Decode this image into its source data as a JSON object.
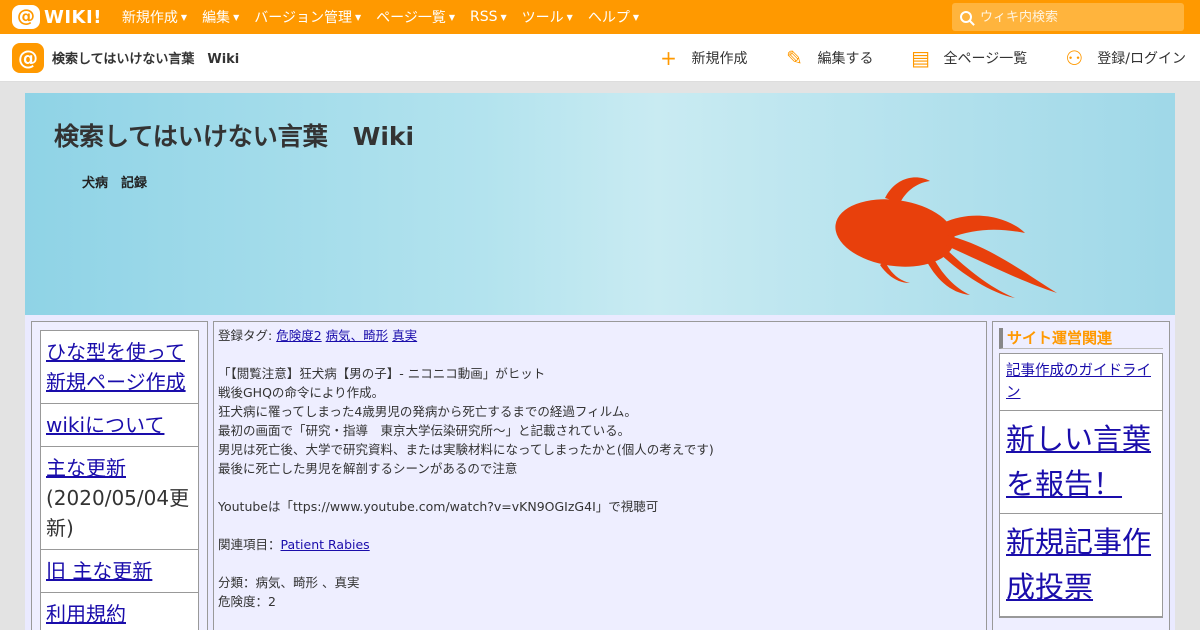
{
  "topbar": {
    "logo_at": "@",
    "logo_text": "WIKI!",
    "nav": [
      {
        "label": "新規作成"
      },
      {
        "label": "編集"
      },
      {
        "label": "バージョン管理"
      },
      {
        "label": "ページ一覧"
      },
      {
        "label": "RSS"
      },
      {
        "label": "ツール"
      },
      {
        "label": "ヘルプ"
      }
    ],
    "search_placeholder": "ウィキ内検索"
  },
  "subbar": {
    "logo_at": "@",
    "wiki_name": "検索してはいけない言葉　Wiki",
    "actions": [
      {
        "icon": "plus-icon",
        "glyph": "+",
        "label": "新規作成"
      },
      {
        "icon": "pencil-icon",
        "glyph": "✎",
        "label": "編集する"
      },
      {
        "icon": "document-icon",
        "glyph": "▤",
        "label": "全ページ一覧"
      },
      {
        "icon": "add-user-icon",
        "glyph": "⚇",
        "label": "登録/ログイン"
      }
    ]
  },
  "banner": {
    "title": "検索してはいけない言葉　Wiki",
    "subtitle": "犬病　記録"
  },
  "left_menu": {
    "items": [
      {
        "link": "ひな型を使って新規ページ作成",
        "note": ""
      },
      {
        "link": "wikiについて",
        "note": ""
      },
      {
        "link": "主な更新",
        "note": "(2020/05/04更新)"
      },
      {
        "link": "旧 主な更新",
        "note": ""
      },
      {
        "link": "利用規約",
        "note": ""
      }
    ]
  },
  "main": {
    "tags_label": "登録タグ: ",
    "tags": [
      "危険度2",
      "病気、畸形",
      "真実"
    ],
    "paragraph1": [
      "「【閲覧注意】狂犬病【男の子】- ニコニコ動画」がヒット",
      "戦後GHQの命令により作成。",
      "狂犬病に罹ってしまった4歳男児の発病から死亡するまでの経過フィルム。",
      "最初の画面で「研究・指導　東京大学伝染研究所～」と記載されている。",
      "男児は死亡後、大学で研究資料、または実験材料になってしまったかと(個人の考えです)",
      "最後に死亡した男児を解剖するシーンがあるので注意"
    ],
    "youtube_line": "Youtubeは「ttps://www.youtube.com/watch?v=vKN9OGIzG4I」で視聴可",
    "related_label": "関連項目：",
    "related_link": "Patient Rabies",
    "category_line": "分類：病気、畸形 、真実",
    "danger_line": "危険度：2"
  },
  "right_menu": {
    "heading": "サイト運営関連",
    "items": [
      {
        "label": "記事作成のガイドライン",
        "size": "small"
      },
      {
        "label": "新しい言葉を報告！",
        "size": "big"
      },
      {
        "label": "新規記事作成投票",
        "size": "big"
      }
    ]
  },
  "colors": {
    "brand_orange": "#ff9900",
    "link_blue": "#1a0dab",
    "goldfish": "#e8400c"
  }
}
